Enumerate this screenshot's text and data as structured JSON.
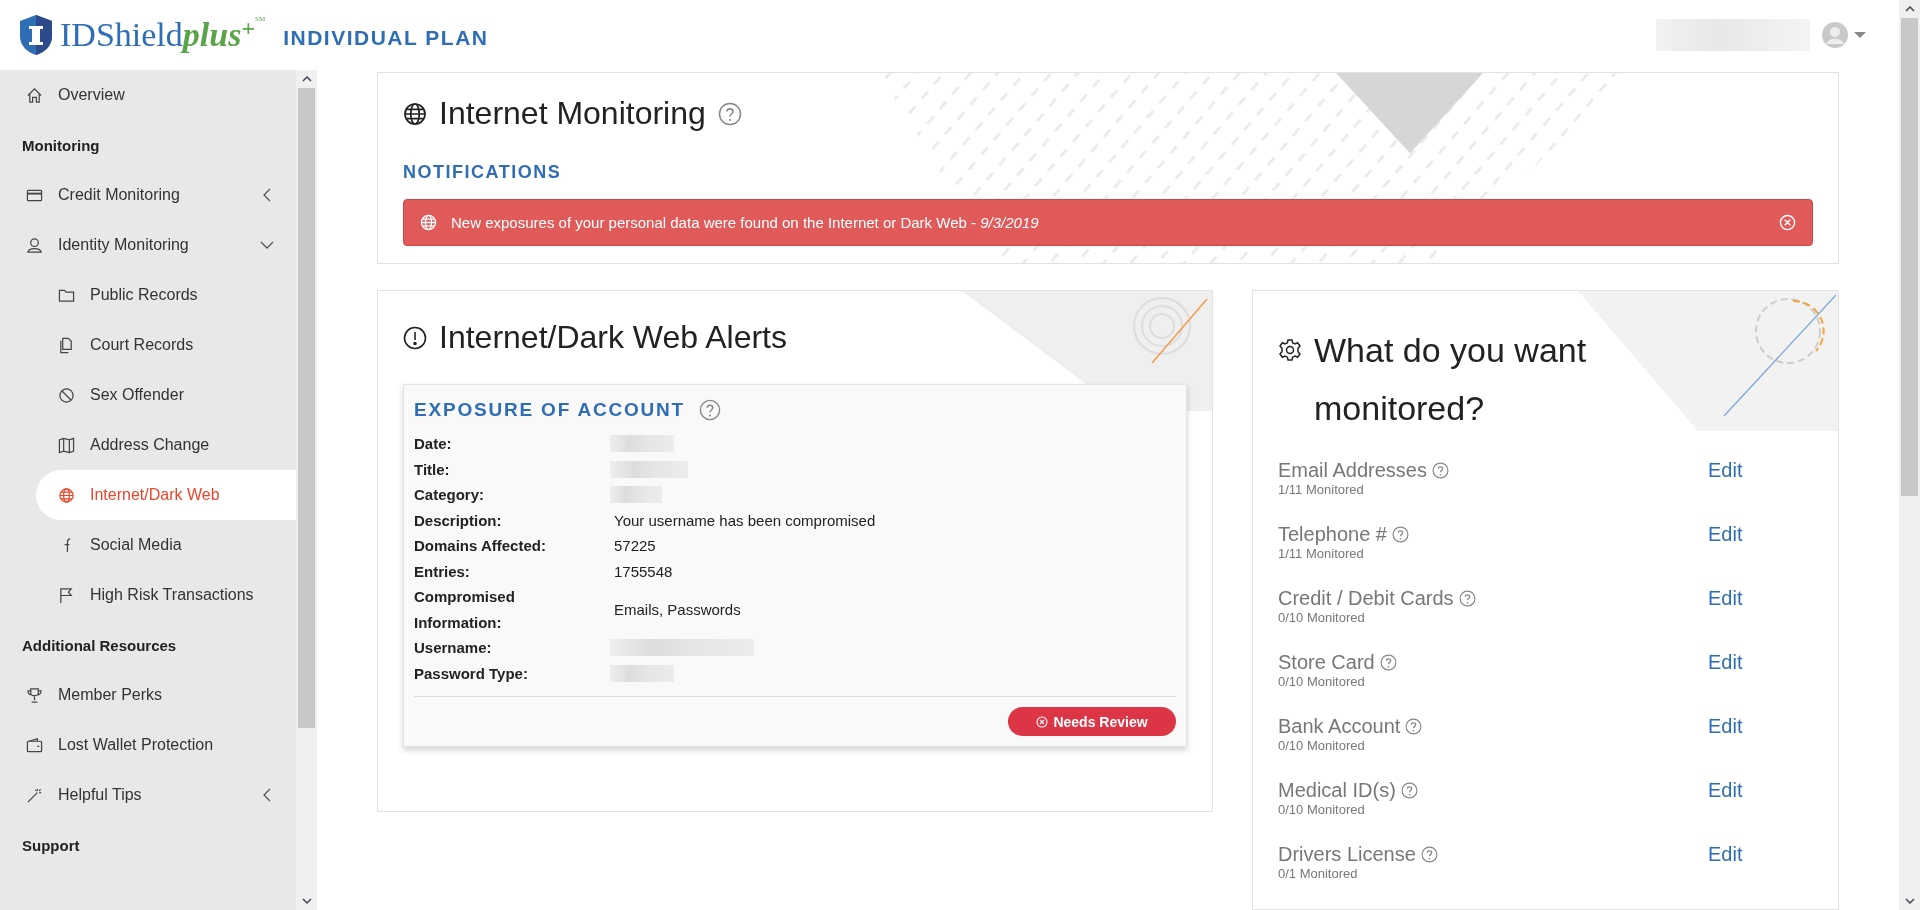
{
  "header": {
    "brand": "IDShield",
    "brand_accent": "plus",
    "brand_plus": "+",
    "brand_mark": "SM",
    "plan": "INDIVIDUAL PLAN"
  },
  "sidebar": {
    "entries": [
      {
        "kind": "link",
        "label": "Overview",
        "selected": false
      },
      {
        "kind": "heading",
        "label": "Monitoring"
      },
      {
        "kind": "link",
        "label": "Credit Monitoring",
        "selected": false,
        "expanded": false
      },
      {
        "kind": "link",
        "label": "Identity Monitoring",
        "selected": false,
        "expanded": true,
        "children": [
          {
            "label": "Public Records",
            "selected": false
          },
          {
            "label": "Court Records",
            "selected": false
          },
          {
            "label": "Sex Offender",
            "selected": false
          },
          {
            "label": "Address Change",
            "selected": false
          },
          {
            "label": "Internet/Dark Web",
            "selected": true
          },
          {
            "label": "Social Media",
            "selected": false
          },
          {
            "label": "High Risk Transactions",
            "selected": false
          }
        ]
      },
      {
        "kind": "heading",
        "label": "Additional Resources"
      },
      {
        "kind": "link",
        "label": "Member Perks",
        "selected": false
      },
      {
        "kind": "link",
        "label": "Lost Wallet Protection",
        "selected": false
      },
      {
        "kind": "link",
        "label": "Helpful Tips",
        "selected": false,
        "expanded": false
      },
      {
        "kind": "heading",
        "label": "Support"
      }
    ]
  },
  "monitoring": {
    "title": "Internet Monitoring",
    "section": "NOTIFICATIONS",
    "notifications": [
      {
        "text": "New exposures of your personal data were found on the Internet or Dark Web - *9/3/2019*"
      }
    ]
  },
  "alerts": {
    "title": "Internet/Dark Web Alerts",
    "items": [
      {
        "title": "EXPOSURE OF ACCOUNT",
        "fields": [
          {
            "label": "Date:",
            "kind": "redacted"
          },
          {
            "label": "Title:",
            "kind": "redacted"
          },
          {
            "label": "Category:",
            "kind": "redacted"
          },
          {
            "label": "Description:",
            "kind": "text",
            "value": "Your username has been compromised"
          },
          {
            "label": "Domains Affected:",
            "kind": "text",
            "value": "57225"
          },
          {
            "label": "Entries:",
            "kind": "text",
            "value": "1755548"
          },
          {
            "label": "Compromised Information:",
            "kind": "text",
            "value": "Emails, Passwords"
          },
          {
            "label": "Username:",
            "kind": "redacted"
          },
          {
            "label": "Password Type:",
            "kind": "redacted"
          }
        ],
        "status": "Needs Review"
      }
    ]
  },
  "monitored": {
    "title": "What do you want monitored?",
    "items": [
      {
        "name": "Email Addresses",
        "count": "1/11 Monitored",
        "action": "Edit"
      },
      {
        "name": "Telephone #",
        "count": "1/11 Monitored",
        "action": "Edit"
      },
      {
        "name": "Credit / Debit Cards",
        "count": "0/10 Monitored",
        "action": "Edit"
      },
      {
        "name": "Store Card",
        "count": "0/10 Monitored",
        "action": "Edit"
      },
      {
        "name": "Bank Account",
        "count": "0/10 Monitored",
        "action": "Edit"
      },
      {
        "name": "Medical ID(s)",
        "count": "0/10 Monitored",
        "action": "Edit"
      },
      {
        "name": "Drivers License",
        "count": "0/1 Monitored",
        "action": "Edit"
      }
    ]
  }
}
